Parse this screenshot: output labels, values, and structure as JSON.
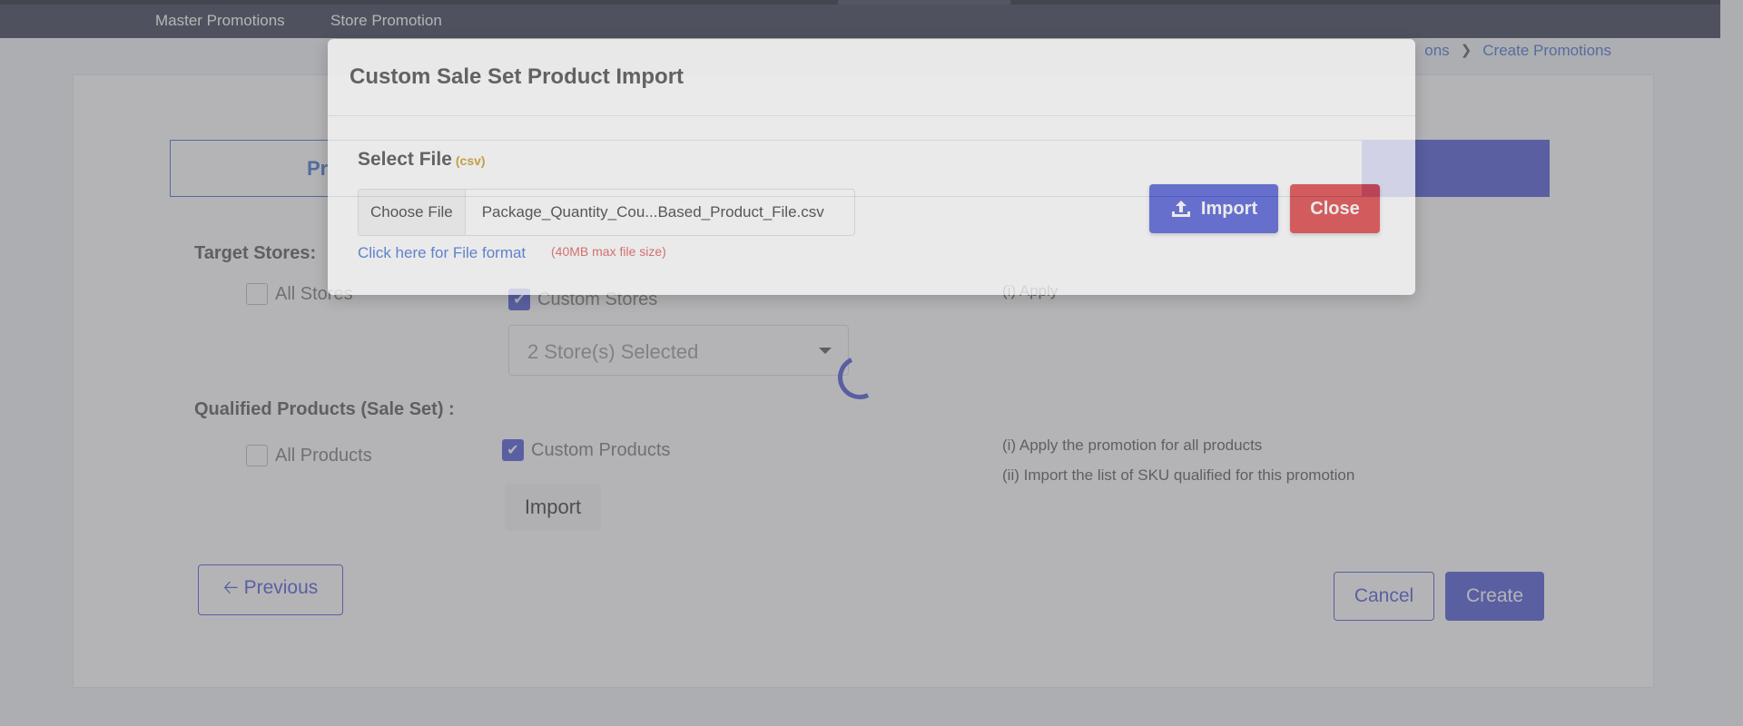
{
  "nav": {
    "items": [
      "Master Promotions",
      "Store Promotion"
    ]
  },
  "breadcrumb": {
    "prev": "ons",
    "current": "Create Promotions"
  },
  "steps": {
    "first_label_partial": "Pr"
  },
  "target_stores": {
    "label": "Target Stores:",
    "all_label": "All Stores",
    "custom_label": "Custom Stores",
    "selected_text": "2 Store(s) Selected",
    "hint_partial": "(i) Apply"
  },
  "qualified_products": {
    "label": "Qualified Products (Sale Set) :",
    "all_label": "All Products",
    "custom_label": "Custom Products",
    "import_label": "Import",
    "hints": [
      "(i) Apply the promotion for all products",
      "(ii) Import the list of SKU qualified for this promotion"
    ]
  },
  "footer": {
    "previous": "Previous",
    "cancel": "Cancel",
    "create": "Create"
  },
  "modal": {
    "title": "Custom Sale Set Product Import",
    "select_file_label": "Select File",
    "file_type_tag": "(csv)",
    "choose_file": "Choose File",
    "file_name": "Package_Quantity_Cou...Based_Product_File.csv",
    "format_link": "Click here for File format",
    "size_note": "(40MB max file size)",
    "import_button": "Import",
    "close_button": "Close"
  },
  "colors": {
    "primary": "#4a55d6",
    "danger": "#de3b3b",
    "link": "#3f6fd1",
    "nav_bg": "#343a4e"
  }
}
